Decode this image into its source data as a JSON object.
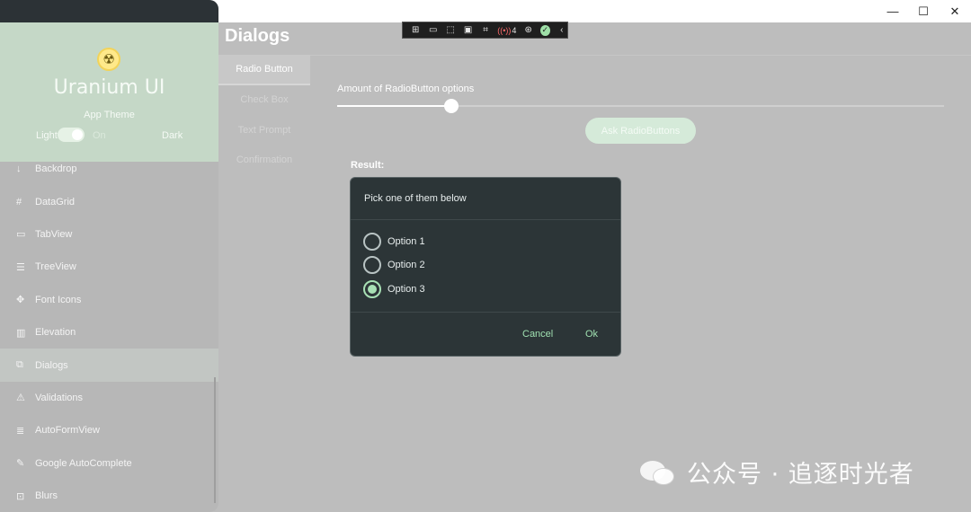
{
  "window": {
    "minimize_icon": "minimize-icon",
    "maximize_icon": "maximize-icon",
    "close_icon": "close-icon",
    "minimize_glyph": "—",
    "maximize_glyph": "☐",
    "close_glyph": "✕"
  },
  "flyout": {
    "logo_icon": "radiation-icon",
    "app_name": "Uranium UI",
    "theme_label": "App Theme",
    "light_label": "Light",
    "on_label": "On",
    "dark_label": "Dark",
    "items": [
      {
        "label": "Backdrop",
        "icon": "arrow-down-icon",
        "glyph": "↓"
      },
      {
        "label": "DataGrid",
        "icon": "hash-icon",
        "glyph": "#"
      },
      {
        "label": "TabView",
        "icon": "tab-icon",
        "glyph": "▭"
      },
      {
        "label": "TreeView",
        "icon": "list-icon",
        "glyph": "☰"
      },
      {
        "label": "Font Icons",
        "icon": "font-icon",
        "glyph": "✥"
      },
      {
        "label": "Elevation",
        "icon": "columns-icon",
        "glyph": "▥"
      },
      {
        "label": "Dialogs",
        "icon": "dialog-icon",
        "glyph": "⧉"
      },
      {
        "label": "Validations",
        "icon": "warning-icon",
        "glyph": "⚠"
      },
      {
        "label": "AutoFormView",
        "icon": "form-icon",
        "glyph": "≣"
      },
      {
        "label": "Google AutoComplete",
        "icon": "autocomplete-icon",
        "glyph": "✎"
      },
      {
        "label": "Blurs",
        "icon": "blur-icon",
        "glyph": "⊡"
      }
    ],
    "active_item": "Dialogs"
  },
  "page": {
    "title": "Dialogs",
    "tabs": [
      "Radio Button",
      "Check Box",
      "Text Prompt",
      "Confirmation"
    ],
    "active_tab": "Radio Button"
  },
  "radio_page": {
    "slider_label": "Amount of RadioButton options",
    "slider_value_fraction": 0.188,
    "ask_button": "Ask RadioButtons",
    "result_label": "Result:"
  },
  "debug_toolbar": {
    "icons": [
      "live-tree-icon",
      "record-icon",
      "select-element-icon",
      "layout-adorner-icon",
      "track-focus-icon",
      "binding-failures-icon",
      "accessibility-icon",
      "hot-reload-icon",
      "collapse-icon"
    ],
    "binding_failures_count": "4"
  },
  "dialog": {
    "title": "Pick one of them below",
    "options": [
      "Option 1",
      "Option 2",
      "Option 3"
    ],
    "selected_index": 2,
    "cancel_label": "Cancel",
    "ok_label": "Ok"
  },
  "watermark": {
    "text": "公众号 · 追逐时光者",
    "icon": "wechat-icon"
  },
  "colors": {
    "accent": "#a8e0b4",
    "dialog_bg": "#2c3537",
    "header_bg": "#c5d8c7",
    "overlay_gray": "#bdbdbd"
  }
}
